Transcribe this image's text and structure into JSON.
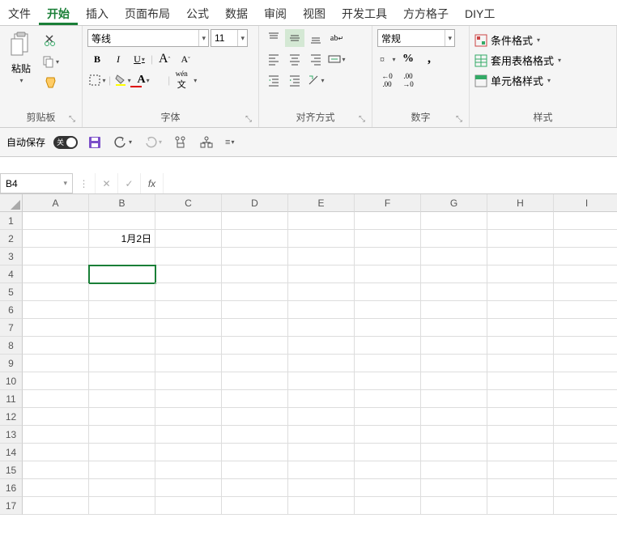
{
  "menubar": {
    "tabs": [
      "文件",
      "开始",
      "插入",
      "页面布局",
      "公式",
      "数据",
      "审阅",
      "视图",
      "开发工具",
      "方方格子",
      "DIY工"
    ],
    "active_index": 1
  },
  "ribbon": {
    "clipboard": {
      "label": "剪贴板",
      "paste": "粘贴"
    },
    "font": {
      "label": "字体",
      "name": "等线",
      "size": "11",
      "bold": "B",
      "italic": "I",
      "underline": "U",
      "grow": "A",
      "shrink": "A",
      "phonetic": "wén"
    },
    "alignment": {
      "label": "对齐方式",
      "wrap": "ab"
    },
    "number": {
      "label": "数字",
      "format": "常规",
      "percent": "%",
      "comma": ",",
      "inc": ".00",
      "dec": ".00"
    },
    "styles": {
      "label": "样式",
      "conditional": "条件格式",
      "table": "套用表格格式",
      "cell": "单元格样式"
    }
  },
  "qat": {
    "autosave_label": "自动保存",
    "autosave_state": "关"
  },
  "formula_bar": {
    "namebox": "B4",
    "fx": "fx",
    "value": ""
  },
  "grid": {
    "columns": [
      "A",
      "B",
      "C",
      "D",
      "E",
      "F",
      "G",
      "H",
      "I"
    ],
    "row_count": 17,
    "selected": "B4",
    "cells": {
      "B2": "1月2日"
    }
  }
}
